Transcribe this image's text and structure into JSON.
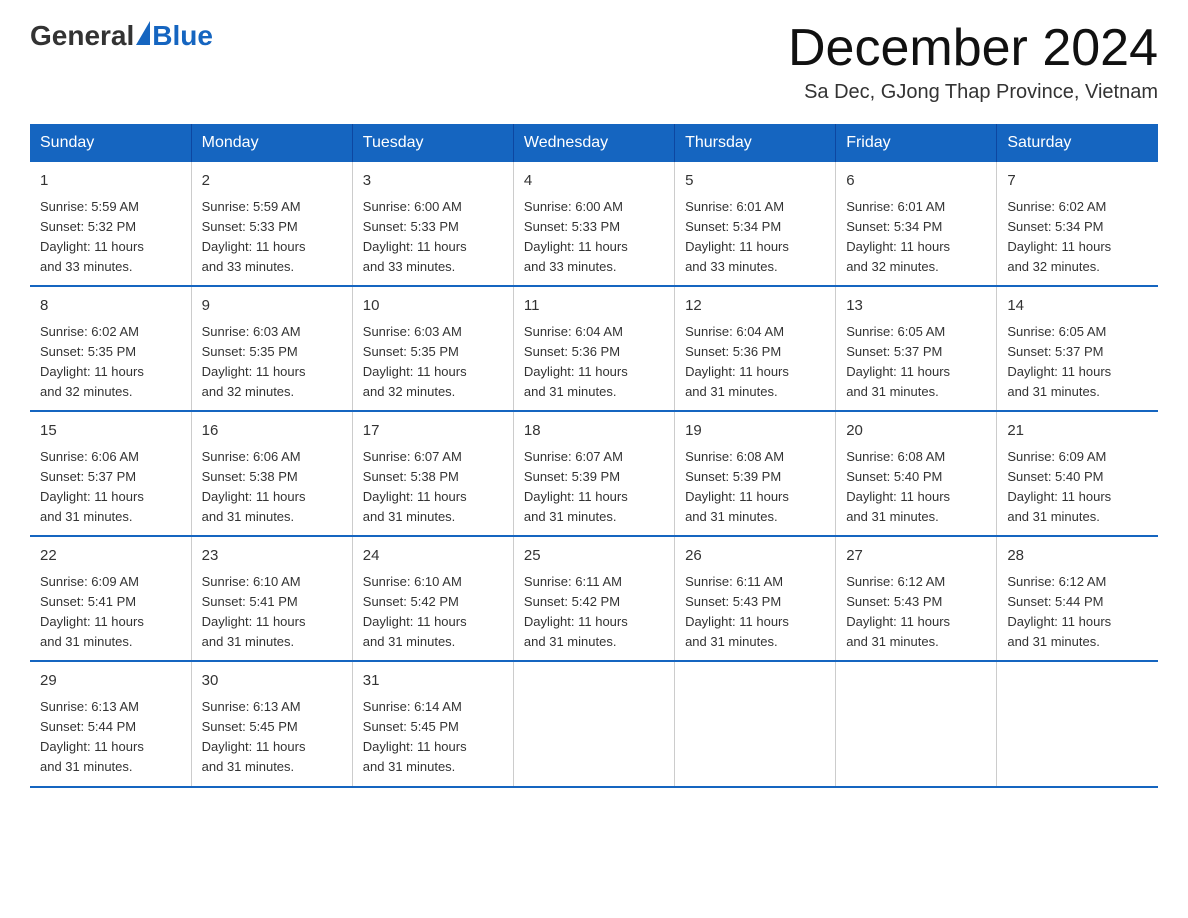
{
  "header": {
    "logo_general": "General",
    "logo_blue": "Blue",
    "month_title": "December 2024",
    "location": "Sa Dec, GJong Thap Province, Vietnam"
  },
  "days_of_week": [
    "Sunday",
    "Monday",
    "Tuesday",
    "Wednesday",
    "Thursday",
    "Friday",
    "Saturday"
  ],
  "weeks": [
    [
      {
        "day": "1",
        "info": "Sunrise: 5:59 AM\nSunset: 5:32 PM\nDaylight: 11 hours\nand 33 minutes."
      },
      {
        "day": "2",
        "info": "Sunrise: 5:59 AM\nSunset: 5:33 PM\nDaylight: 11 hours\nand 33 minutes."
      },
      {
        "day": "3",
        "info": "Sunrise: 6:00 AM\nSunset: 5:33 PM\nDaylight: 11 hours\nand 33 minutes."
      },
      {
        "day": "4",
        "info": "Sunrise: 6:00 AM\nSunset: 5:33 PM\nDaylight: 11 hours\nand 33 minutes."
      },
      {
        "day": "5",
        "info": "Sunrise: 6:01 AM\nSunset: 5:34 PM\nDaylight: 11 hours\nand 33 minutes."
      },
      {
        "day": "6",
        "info": "Sunrise: 6:01 AM\nSunset: 5:34 PM\nDaylight: 11 hours\nand 32 minutes."
      },
      {
        "day": "7",
        "info": "Sunrise: 6:02 AM\nSunset: 5:34 PM\nDaylight: 11 hours\nand 32 minutes."
      }
    ],
    [
      {
        "day": "8",
        "info": "Sunrise: 6:02 AM\nSunset: 5:35 PM\nDaylight: 11 hours\nand 32 minutes."
      },
      {
        "day": "9",
        "info": "Sunrise: 6:03 AM\nSunset: 5:35 PM\nDaylight: 11 hours\nand 32 minutes."
      },
      {
        "day": "10",
        "info": "Sunrise: 6:03 AM\nSunset: 5:35 PM\nDaylight: 11 hours\nand 32 minutes."
      },
      {
        "day": "11",
        "info": "Sunrise: 6:04 AM\nSunset: 5:36 PM\nDaylight: 11 hours\nand 31 minutes."
      },
      {
        "day": "12",
        "info": "Sunrise: 6:04 AM\nSunset: 5:36 PM\nDaylight: 11 hours\nand 31 minutes."
      },
      {
        "day": "13",
        "info": "Sunrise: 6:05 AM\nSunset: 5:37 PM\nDaylight: 11 hours\nand 31 minutes."
      },
      {
        "day": "14",
        "info": "Sunrise: 6:05 AM\nSunset: 5:37 PM\nDaylight: 11 hours\nand 31 minutes."
      }
    ],
    [
      {
        "day": "15",
        "info": "Sunrise: 6:06 AM\nSunset: 5:37 PM\nDaylight: 11 hours\nand 31 minutes."
      },
      {
        "day": "16",
        "info": "Sunrise: 6:06 AM\nSunset: 5:38 PM\nDaylight: 11 hours\nand 31 minutes."
      },
      {
        "day": "17",
        "info": "Sunrise: 6:07 AM\nSunset: 5:38 PM\nDaylight: 11 hours\nand 31 minutes."
      },
      {
        "day": "18",
        "info": "Sunrise: 6:07 AM\nSunset: 5:39 PM\nDaylight: 11 hours\nand 31 minutes."
      },
      {
        "day": "19",
        "info": "Sunrise: 6:08 AM\nSunset: 5:39 PM\nDaylight: 11 hours\nand 31 minutes."
      },
      {
        "day": "20",
        "info": "Sunrise: 6:08 AM\nSunset: 5:40 PM\nDaylight: 11 hours\nand 31 minutes."
      },
      {
        "day": "21",
        "info": "Sunrise: 6:09 AM\nSunset: 5:40 PM\nDaylight: 11 hours\nand 31 minutes."
      }
    ],
    [
      {
        "day": "22",
        "info": "Sunrise: 6:09 AM\nSunset: 5:41 PM\nDaylight: 11 hours\nand 31 minutes."
      },
      {
        "day": "23",
        "info": "Sunrise: 6:10 AM\nSunset: 5:41 PM\nDaylight: 11 hours\nand 31 minutes."
      },
      {
        "day": "24",
        "info": "Sunrise: 6:10 AM\nSunset: 5:42 PM\nDaylight: 11 hours\nand 31 minutes."
      },
      {
        "day": "25",
        "info": "Sunrise: 6:11 AM\nSunset: 5:42 PM\nDaylight: 11 hours\nand 31 minutes."
      },
      {
        "day": "26",
        "info": "Sunrise: 6:11 AM\nSunset: 5:43 PM\nDaylight: 11 hours\nand 31 minutes."
      },
      {
        "day": "27",
        "info": "Sunrise: 6:12 AM\nSunset: 5:43 PM\nDaylight: 11 hours\nand 31 minutes."
      },
      {
        "day": "28",
        "info": "Sunrise: 6:12 AM\nSunset: 5:44 PM\nDaylight: 11 hours\nand 31 minutes."
      }
    ],
    [
      {
        "day": "29",
        "info": "Sunrise: 6:13 AM\nSunset: 5:44 PM\nDaylight: 11 hours\nand 31 minutes."
      },
      {
        "day": "30",
        "info": "Sunrise: 6:13 AM\nSunset: 5:45 PM\nDaylight: 11 hours\nand 31 minutes."
      },
      {
        "day": "31",
        "info": "Sunrise: 6:14 AM\nSunset: 5:45 PM\nDaylight: 11 hours\nand 31 minutes."
      },
      {
        "day": "",
        "info": ""
      },
      {
        "day": "",
        "info": ""
      },
      {
        "day": "",
        "info": ""
      },
      {
        "day": "",
        "info": ""
      }
    ]
  ]
}
